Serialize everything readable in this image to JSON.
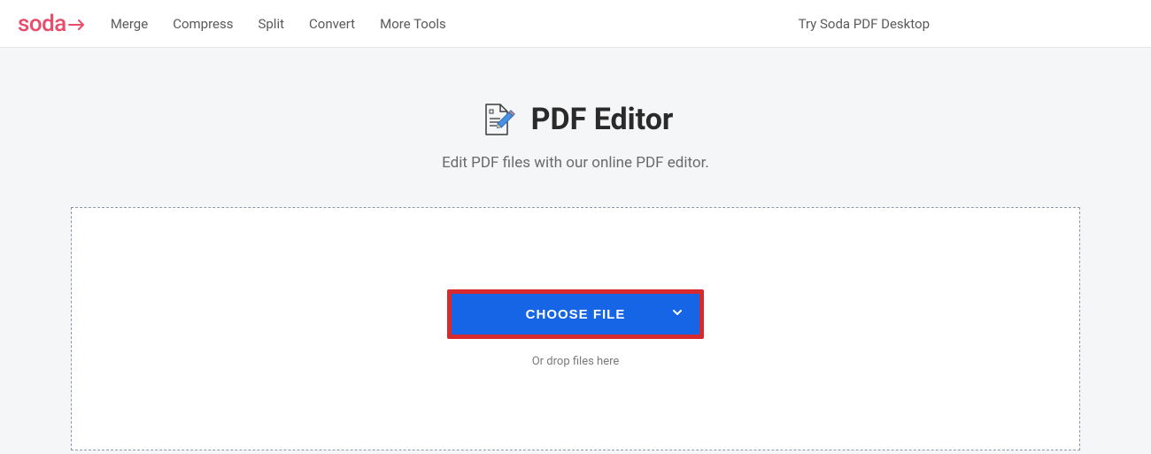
{
  "header": {
    "logo_text": "soda",
    "nav": {
      "merge": "Merge",
      "compress": "Compress",
      "split": "Split",
      "convert": "Convert",
      "more_tools": "More Tools"
    },
    "cta": "Try Soda PDF Desktop"
  },
  "main": {
    "title": "PDF Editor",
    "subtitle": "Edit PDF files with our online PDF editor.",
    "choose_file_label": "CHOOSE FILE",
    "drop_hint": "Or drop files here"
  },
  "colors": {
    "brand": "#e94b6a",
    "primary_button": "#1565e6",
    "highlight_border": "#d62a2f"
  }
}
